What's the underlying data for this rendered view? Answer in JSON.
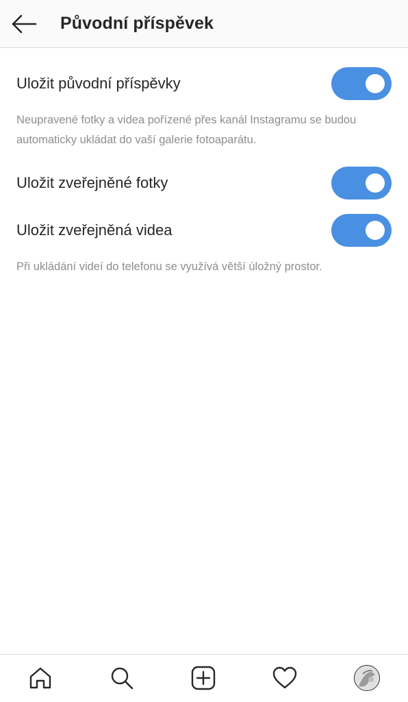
{
  "header": {
    "title": "Původní příspěvek",
    "back_icon": "arrow-left-icon"
  },
  "settings": {
    "save_original": {
      "label": "Uložit původní příspěvky",
      "enabled": true,
      "description": "Neupravené fotky a videa pořízené přes kanál Instagramu se budou automaticky ukládat do vaší galerie fotoaparátu."
    },
    "save_photos": {
      "label": "Uložit zveřejněné fotky",
      "enabled": true
    },
    "save_videos": {
      "label": "Uložit zveřejněná videa",
      "enabled": true,
      "description": "Při ukládání videí do telefonu se využívá větší úložný prostor."
    }
  },
  "bottom_nav": {
    "items": [
      "home-icon",
      "search-icon",
      "add-post-icon",
      "heart-icon",
      "profile-avatar"
    ]
  },
  "colors": {
    "toggle_on": "#4a90e2",
    "text_primary": "#262626",
    "text_secondary": "#8e8e8e",
    "divider": "#dbdbdb"
  }
}
